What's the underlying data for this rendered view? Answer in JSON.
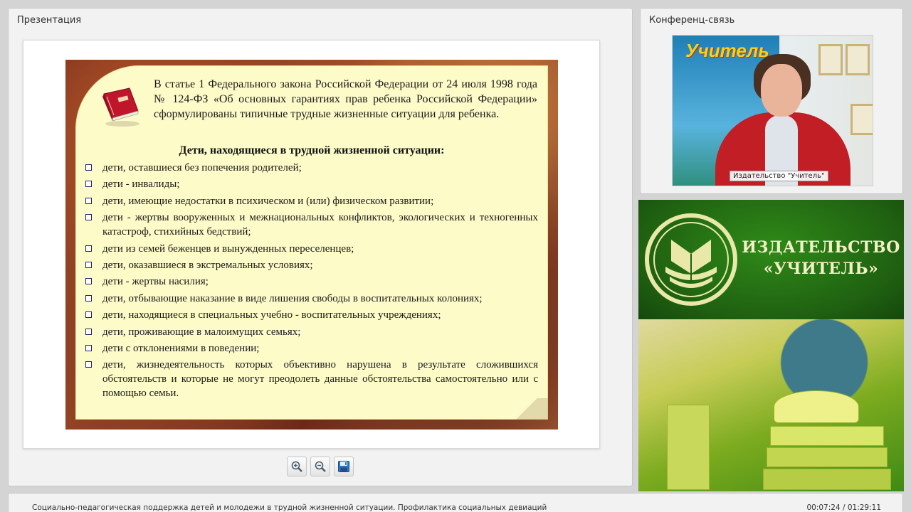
{
  "presentation": {
    "title": "Презентация",
    "slide": {
      "intro": "В статье 1 Федерального закона Российской Федерации от 24 июля 1998 года № 124-ФЗ «Об основных гарантиях прав ребенка Российской Федерации» сформулированы типичные трудные жизненные ситуации для ребенка.",
      "heading": "Дети, находящиеся в трудной жизненной ситуации:",
      "items": [
        "дети, оставшиеся без попечения родителей;",
        "дети - инвалиды;",
        "дети, имеющие недостатки в психическом и (или) физическом развитии;",
        "дети - жертвы вооруженных и межнациональных конфликтов, экологических и техногенных катастроф, стихийных бедствий;",
        "дети из семей беженцев и вынужденных переселенцев;",
        "дети, оказавшиеся в экстремальных условиях;",
        "дети - жертвы насилия;",
        "дети, отбывающие наказание в виде лишения свободы в воспитательных колониях;",
        "дети, находящиеся в специальных учебно - воспитательных учреждениях;",
        "дети, проживающие в малоимущих семьях;",
        "дети с отклонениями в поведении;",
        "дети, жизнедеятельность которых объективно нарушена в результате сложившихся обстоятельств и которые не могут преодолеть данные обстоятельства самостоятельно или с помощью семьи."
      ]
    },
    "toolbar": {
      "zoom_in_icon": "zoom-in-icon",
      "zoom_out_icon": "zoom-out-icon",
      "save_icon": "floppy-disk-icon"
    }
  },
  "conference": {
    "title": "Конференц-связь",
    "video_caption": "Издательство \"Учитель\"",
    "banner_logo": "Учитель"
  },
  "publisher": {
    "line1": "ИЗДАТЕЛЬСТВО",
    "line2": "«УЧИТЕЛЬ»"
  },
  "status": {
    "title": "Социально-педагогическая поддержка детей и молодежи в трудной жизненной ситуации. Профилактика социальных девиаций",
    "time": "00:07:24 / 01:29:11"
  },
  "colors": {
    "paper": "#fdfbc8",
    "publisher_green": "#1f6011",
    "publisher_text": "#f4f0c6"
  }
}
